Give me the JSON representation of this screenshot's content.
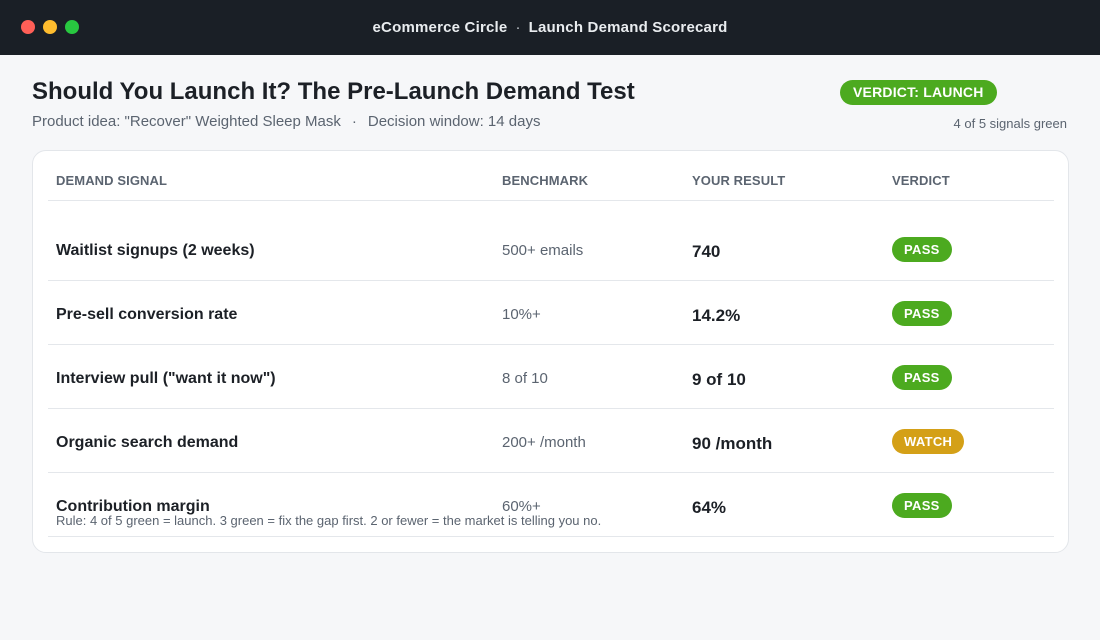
{
  "window": {
    "title_left": "eCommerce Circle",
    "separator": "·",
    "title_right": "Launch Demand Scorecard"
  },
  "header": {
    "title": "Should You Launch It? The Pre-Launch Demand Test",
    "product_idea": "Product idea: \"Recover\" Weighted Sleep Mask",
    "separator": "·",
    "decision_window": "Decision window: 14 days",
    "verdict_badge": "VERDICT: LAUNCH",
    "signal_count": "4 of 5 signals green"
  },
  "table": {
    "columns": [
      "DEMAND SIGNAL",
      "BENCHMARK",
      "YOUR RESULT",
      "VERDICT"
    ],
    "rows": [
      {
        "signal": "Waitlist signups (2 weeks)",
        "benchmark": "500+ emails",
        "result": "740",
        "verdict": "PASS",
        "status": "pass"
      },
      {
        "signal": "Pre-sell conversion rate",
        "benchmark": "10%+",
        "result": "14.2%",
        "verdict": "PASS",
        "status": "pass"
      },
      {
        "signal": "Interview pull (\"want it now\")",
        "benchmark": "8 of 10",
        "result": "9 of 10",
        "verdict": "PASS",
        "status": "pass"
      },
      {
        "signal": "Organic search demand",
        "benchmark": "200+ /month",
        "result": "90 /month",
        "verdict": "WATCH",
        "status": "watch"
      },
      {
        "signal": "Contribution margin",
        "benchmark": "60%+",
        "result": "64%",
        "verdict": "PASS",
        "status": "pass"
      }
    ],
    "rule_note": "Rule: 4 of 5 green = launch. 3 green = fix the gap first. 2 or fewer = the market is telling you no."
  },
  "colors": {
    "pass": "#4caa1f",
    "watch": "#d4a017",
    "titlebar": "#1a1f26"
  }
}
